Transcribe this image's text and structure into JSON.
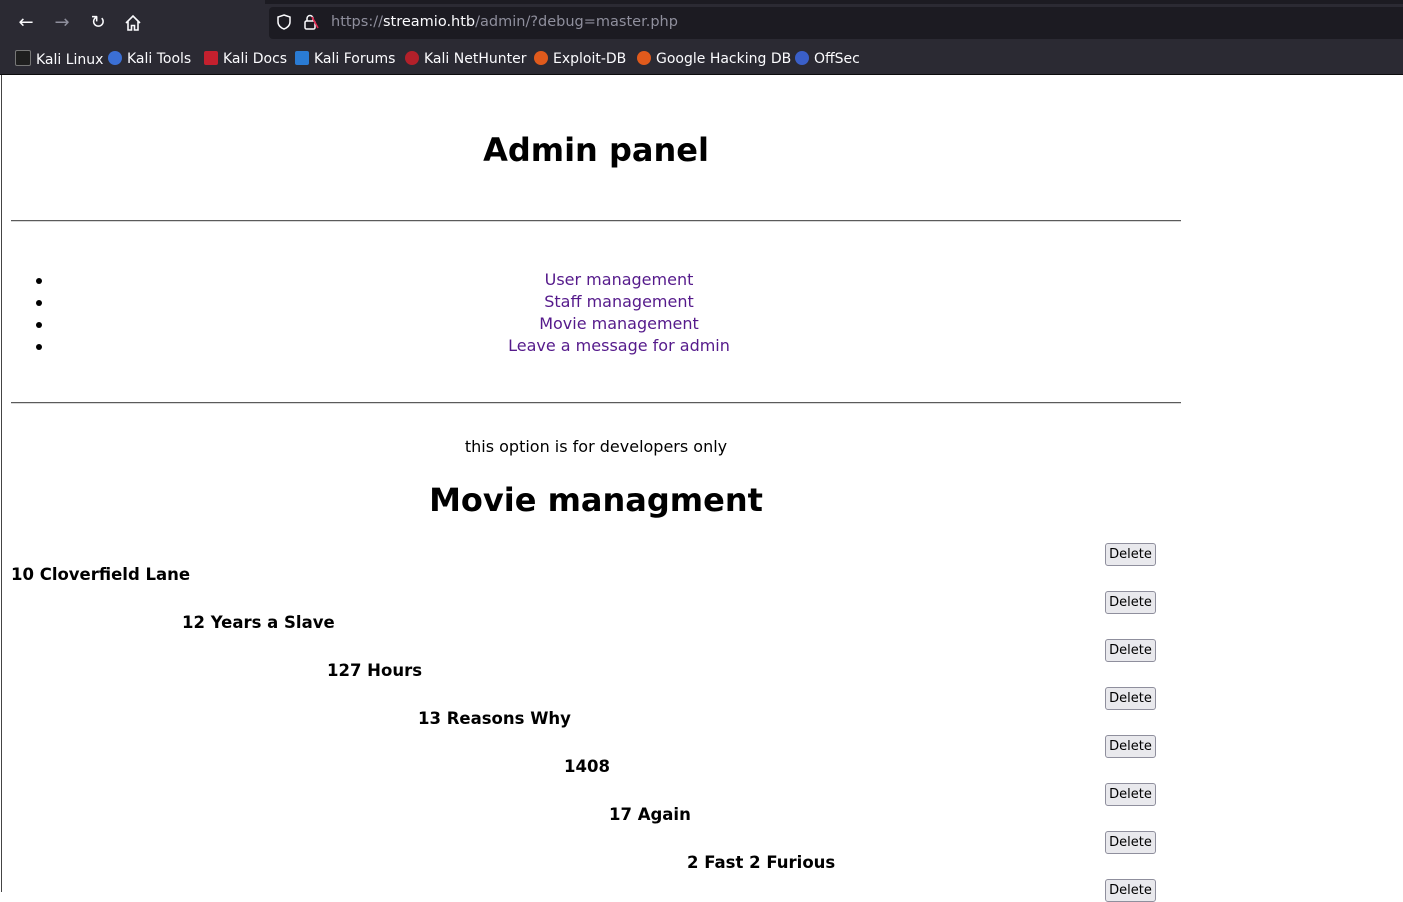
{
  "browser": {
    "url_scheme": "https://",
    "url_host": "streamio.htb",
    "url_path": "/admin/?debug=master.php",
    "bookmarks": [
      "Kali Linux",
      "Kali Tools",
      "Kali Docs",
      "Kali Forums",
      "Kali NetHunter",
      "Exploit-DB",
      "Google Hacking DB",
      "OffSec"
    ]
  },
  "page": {
    "title": "Admin panel",
    "nav": [
      "User management",
      "Staff management",
      "Movie management",
      "Leave a message for admin"
    ],
    "dev_note": "this option is for developers only",
    "section_title": "Movie managment",
    "delete_label": "Delete",
    "movies": [
      "10 Cloverfield Lane",
      "12 Years a Slave",
      "127 Hours",
      "13 Reasons Why",
      "1408",
      "17 Again",
      "2 Fast 2 Furious"
    ]
  }
}
